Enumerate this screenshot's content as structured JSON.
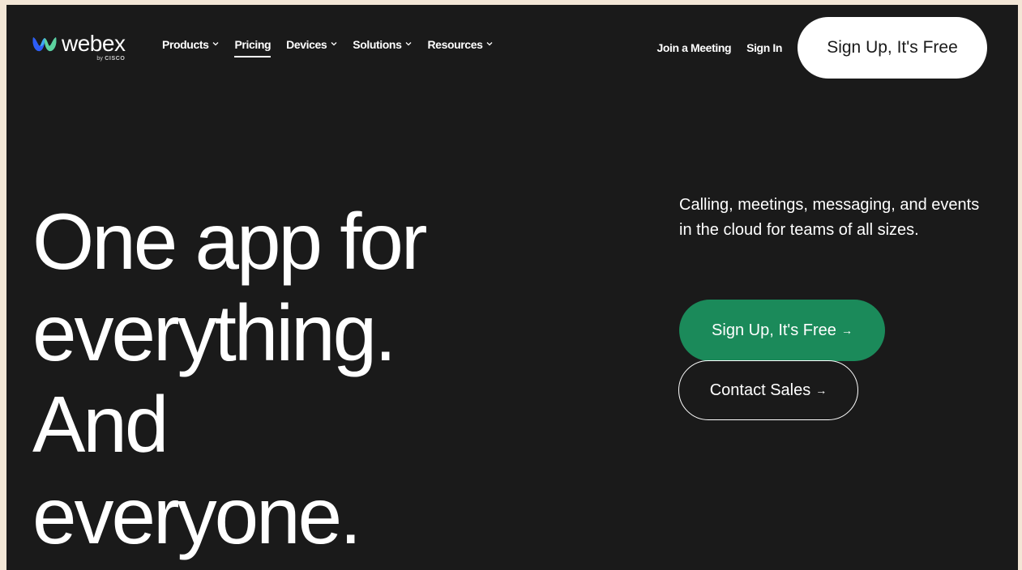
{
  "brand": {
    "name": "webex",
    "sub_prefix": "by",
    "sub_name": "CISCO",
    "logo_icon": "webex-logo-icon",
    "logo_colors": [
      "#3fa9f5",
      "#5dd39e",
      "#2d5cf6"
    ]
  },
  "nav": {
    "items": [
      {
        "label": "Products",
        "dropdown": true
      },
      {
        "label": "Pricing",
        "dropdown": false,
        "active": true
      },
      {
        "label": "Devices",
        "dropdown": true
      },
      {
        "label": "Solutions",
        "dropdown": true
      },
      {
        "label": "Resources",
        "dropdown": true
      }
    ],
    "chevron_icon": "chevron-down-icon"
  },
  "header": {
    "join_label": "Join a Meeting",
    "signin_label": "Sign In",
    "cta_label": "Sign Up, It's Free"
  },
  "hero": {
    "headline_lines": [
      "One app for",
      "everything.",
      "And",
      "everyone."
    ],
    "subtext": "Calling, meetings, messaging, and events in the cloud for teams of all sizes.",
    "primary_label": "Sign Up, It's Free",
    "secondary_label": "Contact Sales",
    "arrow_icon": "arrow-right-icon",
    "arrow_glyph": "→"
  },
  "colors": {
    "background": "#1a1a1a",
    "primary_button": "#1b8a5a",
    "text": "#ffffff",
    "outer_frame": "#f3e6d6"
  }
}
